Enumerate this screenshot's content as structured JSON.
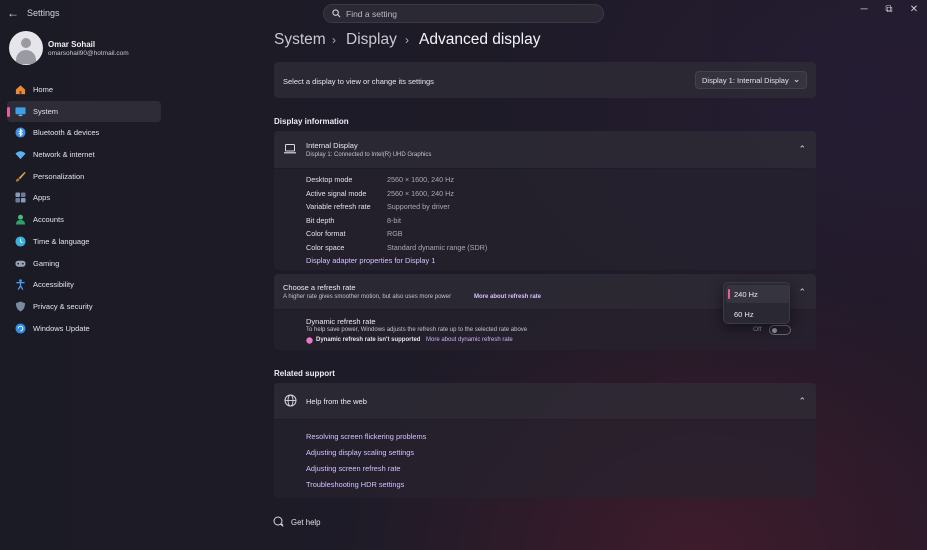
{
  "app": {
    "title": "Settings",
    "back_glyph": "←",
    "minimize": "─",
    "restore": "⧉",
    "close": "✕"
  },
  "search": {
    "placeholder": "Find a setting"
  },
  "user": {
    "name": "Omar Sohail",
    "email": "omarsohail90@hotmail.com"
  },
  "sidebar": {
    "items": [
      {
        "label": "Home",
        "icon": "home-icon",
        "color": "#e98a3a"
      },
      {
        "label": "System",
        "icon": "system-icon",
        "color": "#3aa0e8",
        "active": true
      },
      {
        "label": "Bluetooth & devices",
        "icon": "bluetooth-icon",
        "color": "#3a8ee8"
      },
      {
        "label": "Network & internet",
        "icon": "wifi-icon",
        "color": "#5ab4f0"
      },
      {
        "label": "Personalization",
        "icon": "brush-icon",
        "color": "#e0a050"
      },
      {
        "label": "Apps",
        "icon": "apps-icon",
        "color": "#8a9ab8"
      },
      {
        "label": "Accounts",
        "icon": "accounts-icon",
        "color": "#40c080"
      },
      {
        "label": "Time & language",
        "icon": "globe-clock-icon",
        "color": "#3ab0e0"
      },
      {
        "label": "Gaming",
        "icon": "gaming-icon",
        "color": "#9aa4b4"
      },
      {
        "label": "Accessibility",
        "icon": "accessibility-icon",
        "color": "#4aa0f0"
      },
      {
        "label": "Privacy & security",
        "icon": "shield-icon",
        "color": "#7a8aa0"
      },
      {
        "label": "Windows Update",
        "icon": "update-icon",
        "color": "#2e8ee8"
      }
    ]
  },
  "breadcrumb": {
    "part1": "System",
    "part2": "Display",
    "current": "Advanced display",
    "sep": "›"
  },
  "display_select": {
    "label": "Select a display to view or change its settings",
    "value": "Display 1: Internal Display",
    "chevron": "⌄"
  },
  "display_info": {
    "heading": "Display information",
    "title": "Internal Display",
    "subtitle": "Display 1: Connected to Intel(R) UHD Graphics",
    "rows": [
      {
        "key": "Desktop mode",
        "value": "2560 × 1600, 240 Hz"
      },
      {
        "key": "Active signal mode",
        "value": "2560 × 1600, 240 Hz"
      },
      {
        "key": "Variable refresh rate",
        "value": "Supported by driver"
      },
      {
        "key": "Bit depth",
        "value": "8-bit"
      },
      {
        "key": "Color format",
        "value": "RGB"
      },
      {
        "key": "Color space",
        "value": "Standard dynamic range (SDR)"
      }
    ],
    "adapter_link": "Display adapter properties for Display 1",
    "chevron": "⌃"
  },
  "refresh": {
    "title": "Choose a refresh rate",
    "subtitle": "A higher rate gives smoother motion, but also uses more power",
    "more_link": "More about refresh rate",
    "options": [
      "240 Hz",
      "60 Hz"
    ],
    "selected": "240 Hz",
    "chevron": "⌃"
  },
  "dynamic": {
    "title": "Dynamic refresh rate",
    "subtitle": "To help save power, Windows adjusts the refresh rate up to the selected rate above",
    "warning": "Dynamic refresh rate isn't supported",
    "more_link": "More about dynamic refresh rate",
    "toggle_label": "Off",
    "warning_color": "#e879c8"
  },
  "related": {
    "heading": "Related support",
    "help_title": "Help from the web",
    "chevron": "⌃",
    "links": [
      "Resolving screen flickering problems",
      "Adjusting display scaling settings",
      "Adjusting screen refresh rate",
      "Troubleshooting HDR settings"
    ]
  },
  "footer": {
    "get_help": "Get help"
  }
}
